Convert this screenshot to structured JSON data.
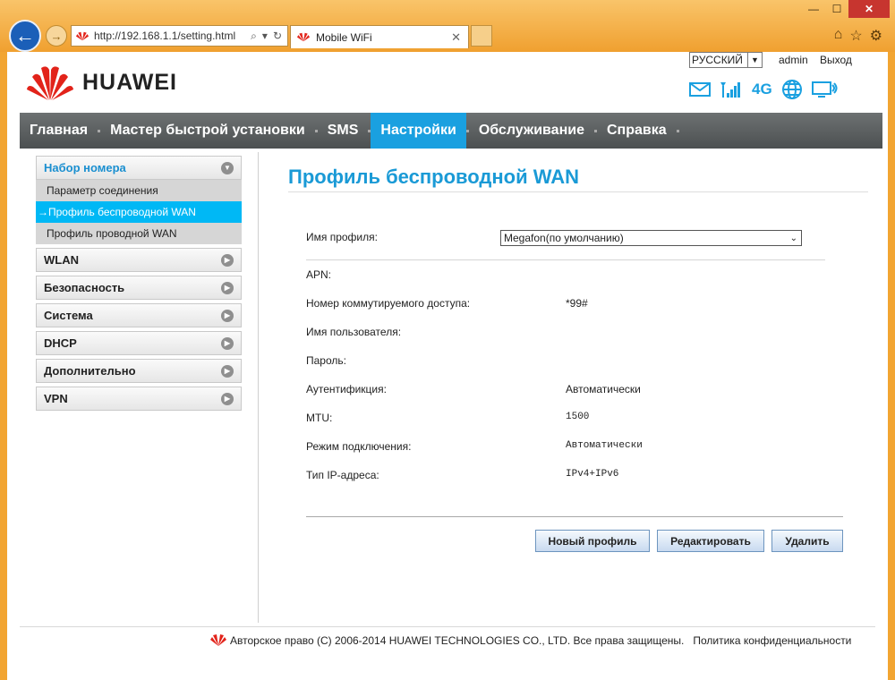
{
  "browser": {
    "url": "http://192.168.1.1/setting.html",
    "tab_title": "Mobile WiFi",
    "tab_close": "✕",
    "win_min": "—",
    "win_max": "☐",
    "win_close": "✕"
  },
  "header": {
    "brand": "HUAWEI",
    "language": "РУССКИЙ",
    "user": "admin",
    "logout": "Выход",
    "network": "4G"
  },
  "nav": [
    {
      "label": "Главная"
    },
    {
      "label": "Мастер быстрой установки"
    },
    {
      "label": "SMS"
    },
    {
      "label": "Настройки",
      "active": true
    },
    {
      "label": "Обслуживание"
    },
    {
      "label": "Справка"
    }
  ],
  "sidebar": {
    "open_group": "Набор номера",
    "sub_items": [
      "Параметр соединения",
      "→Профиль беспроводной WAN",
      "Профиль проводной WAN"
    ],
    "groups": [
      "WLAN",
      "Безопасность",
      "Система",
      "DHCP",
      "Дополнительно",
      "VPN"
    ]
  },
  "content": {
    "title": "Профиль беспроводной WAN",
    "profile_label": "Имя профиля:",
    "profile_value": "Megafon(по умолчанию)",
    "fields": [
      {
        "label": "APN:",
        "value": ""
      },
      {
        "label": "Номер коммутируемого доступа:",
        "value": "*99#"
      },
      {
        "label": "Имя пользователя:",
        "value": ""
      },
      {
        "label": "Пароль:",
        "value": ""
      },
      {
        "label": "Аутентификция:",
        "value": "Автоматически"
      },
      {
        "label": "MTU:",
        "value": "1500"
      },
      {
        "label": "Режим подключения:",
        "value": "Автоматически"
      },
      {
        "label": "Тип IP-адреса:",
        "value": "IPv4+IPv6"
      }
    ],
    "buttons": {
      "new": "Новый профиль",
      "edit": "Редактировать",
      "delete": "Удалить"
    }
  },
  "footer": {
    "copyright": "Авторское право (C) 2006-2014 HUAWEI TECHNOLOGIES CO., LTD. Все права защищены.",
    "privacy": "Политика конфиденциальности"
  },
  "colors": {
    "accent": "#1aa0e0",
    "active_sidebar": "#00b8f5",
    "nav_bg": "#5a5e5f",
    "chrome": "#f2a532"
  }
}
